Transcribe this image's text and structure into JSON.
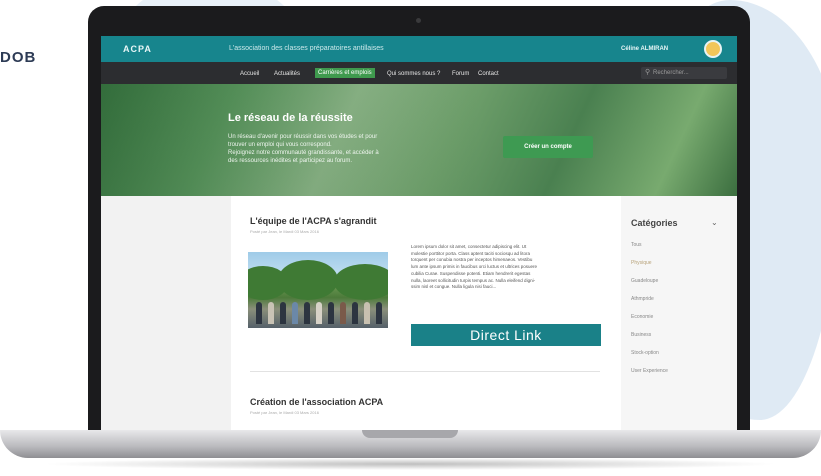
{
  "corner_text": "DOB",
  "site": {
    "logo": "ACPA",
    "tagline": "L'association des classes préparatoires antillaises",
    "user_name": "Céline ALMIRAN"
  },
  "nav": {
    "items": [
      "Accueil",
      "Actualités",
      "Carrières et emplois",
      "Qui sommes nous ?",
      "Forum",
      "Contact"
    ],
    "active_index": 2,
    "search_placeholder": "Rechercher..."
  },
  "hero": {
    "title": "Le réseau de la réussite",
    "text_lines": [
      "Un réseau d'avenir pour réussir dans vos études et pour",
      "trouver un emploi qui vous correspond.",
      "Rejoignez notre communauté grandissante, et accéder à",
      "des ressources inédites et participez au forum."
    ],
    "cta_label": "Créer un compte"
  },
  "posts": [
    {
      "title": "L'équipe de l'ACPA s'agrandit",
      "date": "Posté par Jean, le Mardi 03 Mars 2016",
      "body_lines": [
        "Lorem ipsum dolor sit amet, consectetur adipiscing elit. Ut",
        "molestie porttitor porta. Class aptent taciti sociosqu ad litora",
        "torquent per conubia nostra per inceptos himenaeos. Vestibu",
        "lum ante ipsum primis in faucibus orci luctus et ultrices posuere",
        "cubilia Curae. Suspendisse potenti. Etiam hendrerit egestas",
        "nulla, laoreet sollicitudin turpis tempus ac. Nulla eleifend digni-",
        "ssim nisl et congue. Nulla ligula nisi fauci..."
      ],
      "link_label": "Direct Link"
    },
    {
      "title": "Création de l'association ACPA",
      "date": "Posté par Jean, le Mardi 03 Mars 2016"
    }
  ],
  "sidebar": {
    "title": "Catégories",
    "items": [
      "Tous",
      "Physique",
      "Guadeloupe",
      "Athmpride",
      "Economie",
      "Business",
      "Stock-option",
      "User Experience"
    ],
    "active_index": 1
  },
  "colors": {
    "topbar": "#17858d",
    "navbar": "#2c2d30",
    "accent_green": "#3e9a52",
    "link_teal": "#1a8188"
  }
}
